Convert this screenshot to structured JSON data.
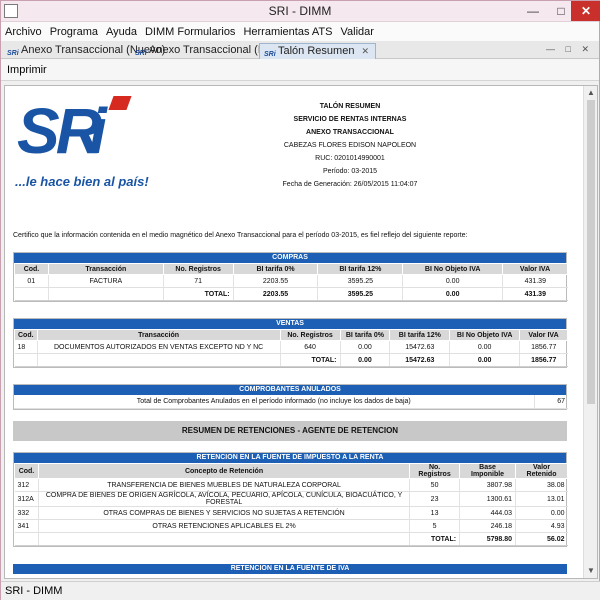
{
  "window": {
    "title": "SRI - DIMM"
  },
  "menu": [
    "Archivo",
    "Programa",
    "Ayuda",
    "DIMM Formularios",
    "Herramientas ATS",
    "Validar"
  ],
  "tabs": [
    {
      "label": "Anexo Transaccional (Nuevo)"
    },
    {
      "label": "Anexo Transaccional (Nuevo)"
    },
    {
      "label": "Talón Resumen"
    }
  ],
  "toolbar": {
    "print_label": "Imprimir"
  },
  "logo": {
    "text": "SRi",
    "slogan": "...le hace bien al país!"
  },
  "header": {
    "title": "TALÓN RESUMEN",
    "org": "SERVICIO DE RENTAS INTERNAS",
    "annex": "ANEXO TRANSACCIONAL",
    "name": "CABEZAS FLORES EDISON NAPOLEON",
    "ruc": "RUC: 0201014990001",
    "period": "Período: 03-2015",
    "generated": "Fecha de Generación: 26/05/2015 11:04:07"
  },
  "certification": "Certifico que la información contenida en el medio magnético del Anexo Transaccional para el período 03-2015, es fiel reflejo del siguiente reporte:",
  "compras": {
    "title": "COMPRAS",
    "headers": [
      "Cod.",
      "Transacción",
      "No. Registros",
      "BI tarifa 0%",
      "BI tarifa 12%",
      "BI No Objeto IVA",
      "Valor IVA"
    ],
    "rows": [
      [
        "01",
        "FACTURA",
        "71",
        "2203.55",
        "3595.25",
        "0.00",
        "431.39"
      ]
    ],
    "total_label": "TOTAL:",
    "totals": [
      "2203.55",
      "3595.25",
      "0.00",
      "431.39"
    ]
  },
  "ventas": {
    "title": "VENTAS",
    "headers": [
      "Cod.",
      "Transacción",
      "No. Registros",
      "BI tarifa 0%",
      "BI tarifa 12%",
      "BI No Objeto IVA",
      "Valor IVA"
    ],
    "rows": [
      [
        "18",
        "DOCUMENTOS AUTORIZADOS EN VENTAS EXCEPTO ND Y NC",
        "640",
        "0.00",
        "15472.63",
        "0.00",
        "1856.77"
      ]
    ],
    "total_label": "TOTAL:",
    "totals": [
      "0.00",
      "15472.63",
      "0.00",
      "1856.77"
    ]
  },
  "anulados": {
    "title": "COMPROBANTES ANULADOS",
    "label": "Total de Comprobantes Anulados en el período informado (no incluye los dados de baja)",
    "value": "67"
  },
  "resumen": {
    "title": "RESUMEN DE RETENCIONES - AGENTE DE RETENCION"
  },
  "renta": {
    "title": "RETENCION EN LA FUENTE DE IMPUESTO A LA RENTA",
    "headers": [
      "Cod.",
      "Concepto de Retención",
      "No. Registros",
      "Base Imponible",
      "Valor Retenido"
    ],
    "rows": [
      [
        "312",
        "TRANSFERENCIA DE BIENES MUEBLES DE NATURALEZA CORPORAL",
        "50",
        "3807.98",
        "38.08"
      ],
      [
        "312A",
        "COMPRA DE BIENES DE ORIGEN AGRÍCOLA, AVÍCOLA, PECUARIO, APÍCOLA, CUNÍCULA, BIOACUÁTICO, Y FORESTAL",
        "23",
        "1300.61",
        "13.01"
      ],
      [
        "332",
        "OTRAS COMPRAS DE BIENES Y SERVICIOS NO SUJETAS A RETENCIÓN",
        "13",
        "444.03",
        "0.00"
      ],
      [
        "341",
        "OTRAS RETENCIONES APLICABLES EL 2%",
        "5",
        "246.18",
        "4.93"
      ]
    ],
    "total_label": "TOTAL:",
    "totals": [
      "5798.80",
      "56.02"
    ]
  },
  "iva": {
    "title": "RETENCION EN LA FUENTE DE IVA"
  },
  "status": {
    "text": "SRI - DIMM"
  }
}
